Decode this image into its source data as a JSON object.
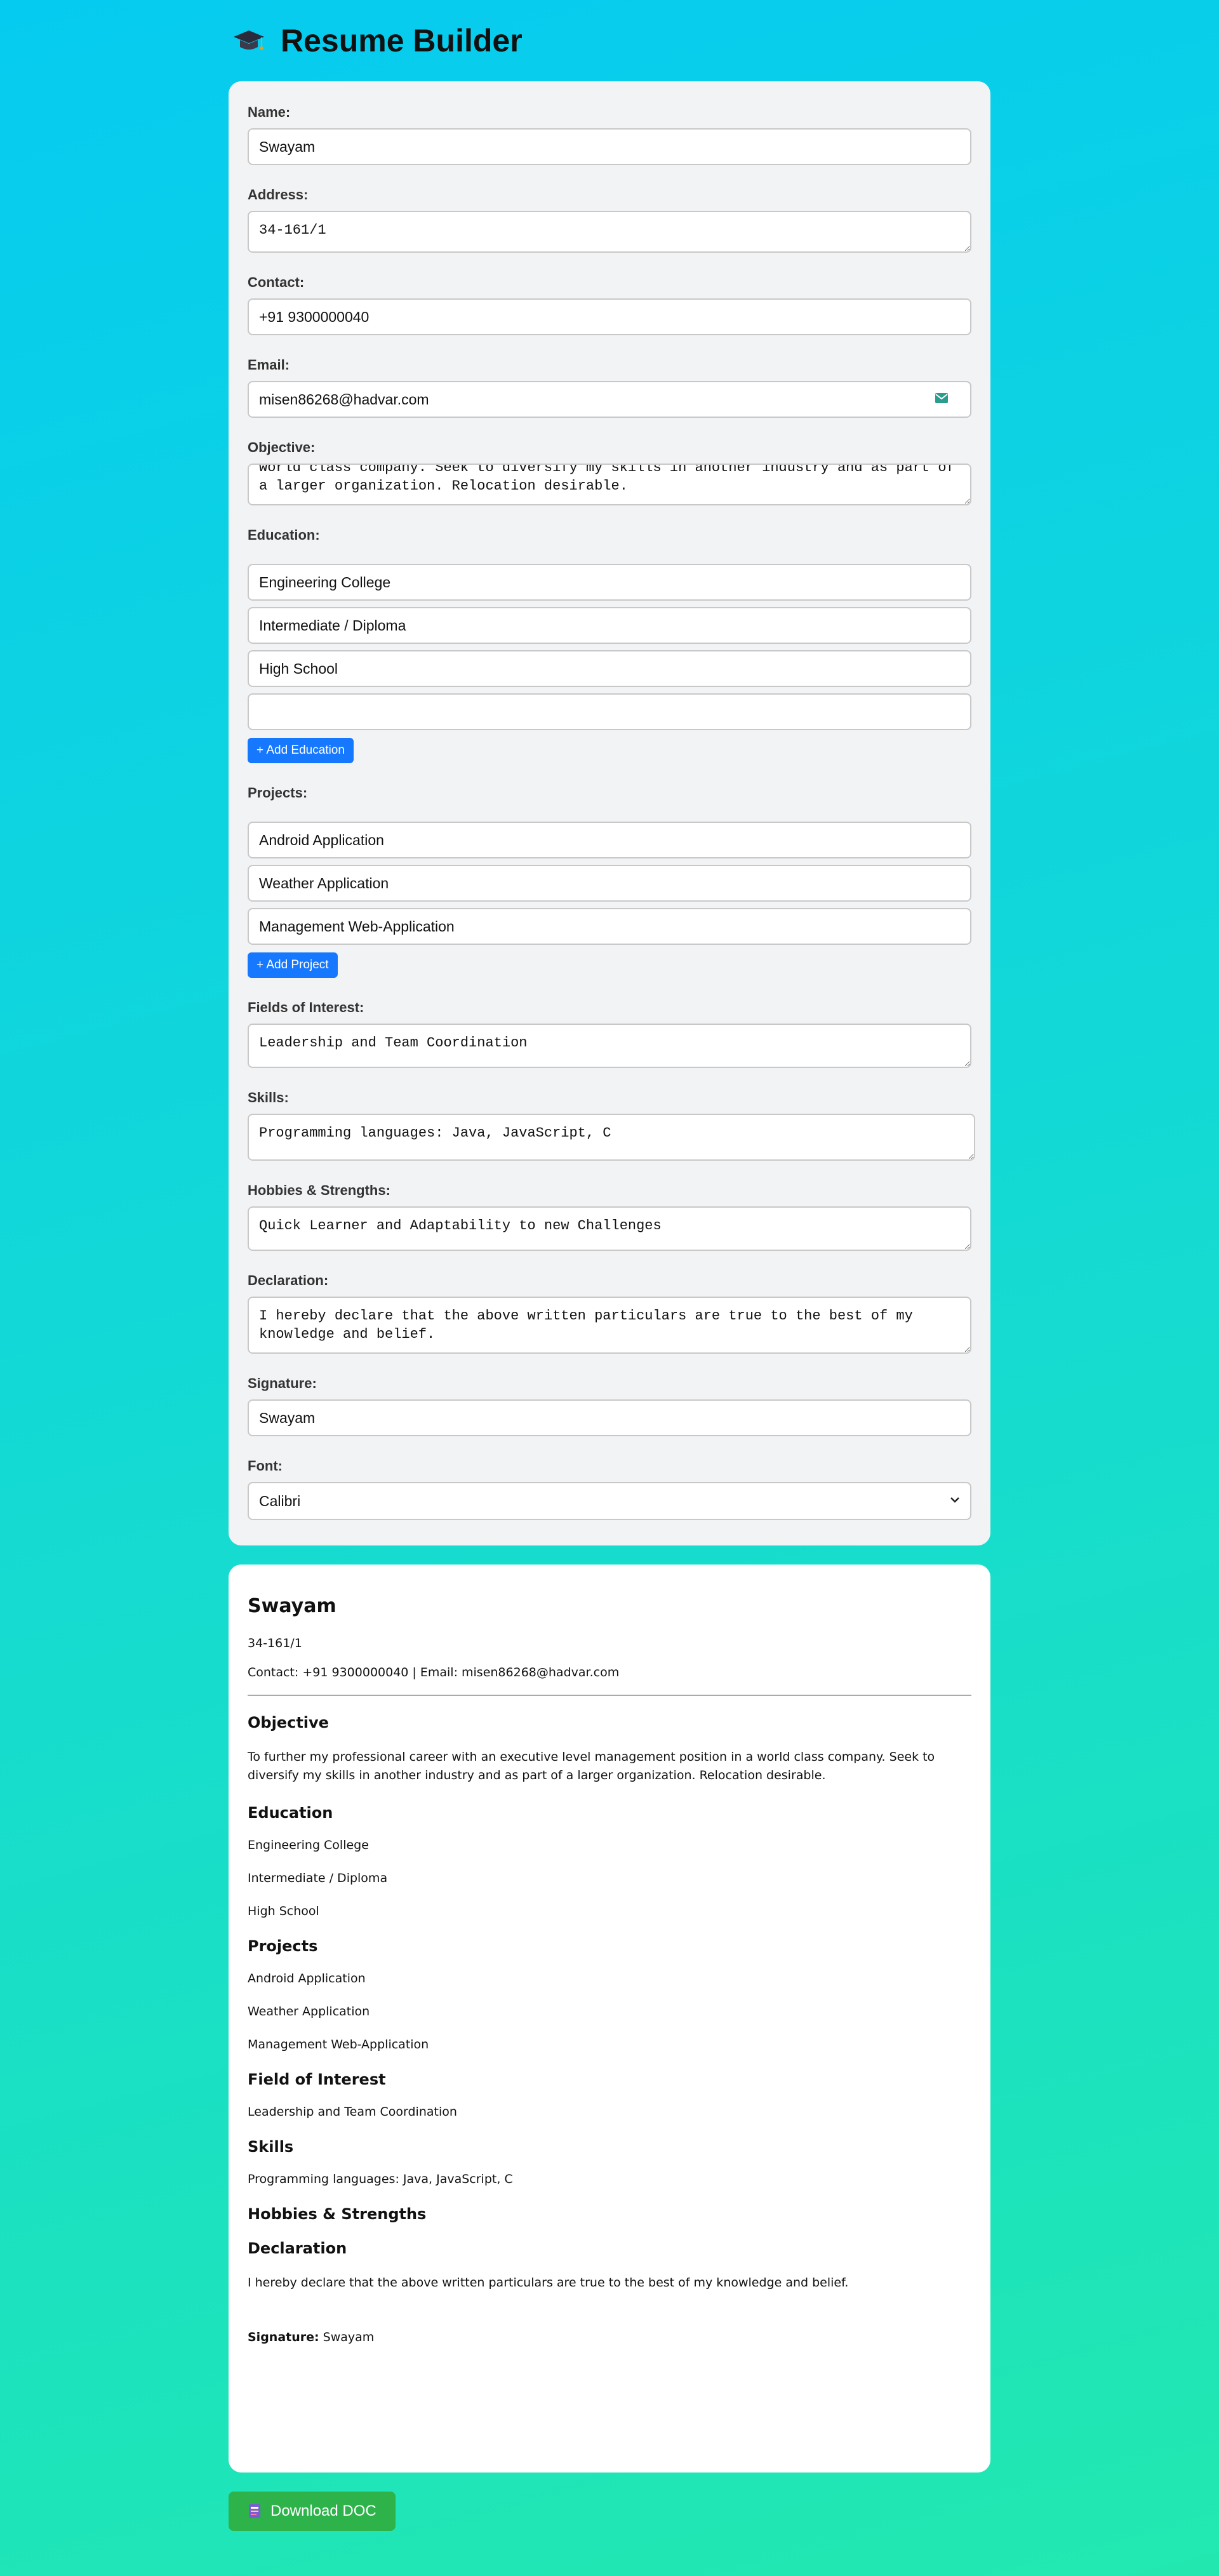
{
  "app": {
    "title": "Resume Builder",
    "icon": "graduation-cap-icon"
  },
  "form": {
    "name": {
      "label": "Name:",
      "value": "Swayam"
    },
    "address": {
      "label": "Address:",
      "value": "34-161/1"
    },
    "contact": {
      "label": "Contact:",
      "value": "+91 9300000040"
    },
    "email": {
      "label": "Email:",
      "value": "misen86268@hadvar.com"
    },
    "objective": {
      "label": "Objective:",
      "value": "To further my professional career with an executive level management position in a world class company. Seek to diversify my skills in another industry and as part of a larger organization. Relocation desirable."
    },
    "education": {
      "label": "Education:",
      "items": [
        "Engineering College",
        "Intermediate / Diploma",
        "High School",
        ""
      ],
      "add_label": "+ Add Education"
    },
    "projects": {
      "label": "Projects:",
      "items": [
        "Android Application",
        "Weather Application",
        "Management Web-Application"
      ],
      "add_label": "+ Add Project"
    },
    "interest": {
      "label": "Fields of Interest:",
      "value": "Leadership and Team Coordination"
    },
    "skills": {
      "label": "Skills:",
      "value": "Programming languages: Java, JavaScript, C"
    },
    "hobbies": {
      "label": "Hobbies & Strengths:",
      "value": "Quick Learner and Adaptability to new Challenges"
    },
    "declaration": {
      "label": "Declaration:",
      "value": "I hereby declare that the above written particulars are true to the best of my knowledge and belief."
    },
    "signature": {
      "label": "Signature:",
      "value": "Swayam"
    },
    "font": {
      "label": "Font:",
      "value": "Calibri"
    }
  },
  "preview": {
    "name": "Swayam",
    "address": "34-161/1",
    "contact_line": "Contact: +91 9300000040 | Email: misen86268@hadvar.com",
    "objective_heading": "Objective",
    "objective_text": "To further my professional career with an executive level management position in a world class company. Seek to diversify my skills in another industry and as part of a larger organization. Relocation desirable.",
    "education_heading": "Education",
    "education": [
      "Engineering College",
      "Intermediate / Diploma",
      "High School"
    ],
    "projects_heading": "Projects",
    "projects": [
      "Android Application",
      "Weather Application",
      "Management Web-Application"
    ],
    "interest_heading": "Field of Interest",
    "interest_text": "Leadership and Team Coordination",
    "skills_heading": "Skills",
    "skills_text": "Programming languages: Java, JavaScript, C",
    "hobbies_heading": "Hobbies & Strengths",
    "declaration_heading": "Declaration",
    "declaration_text": "I hereby declare that the above written particulars are true to the best of my knowledge and belief.",
    "signature_label": "Signature:",
    "signature_value": "Swayam"
  },
  "download": {
    "label": "Download DOC",
    "icon": "document-icon"
  },
  "colors": {
    "accent": "#1677ff",
    "download": "#2db34a",
    "bg_top": "#06cbf0",
    "bg_bottom": "#22e8b0"
  }
}
